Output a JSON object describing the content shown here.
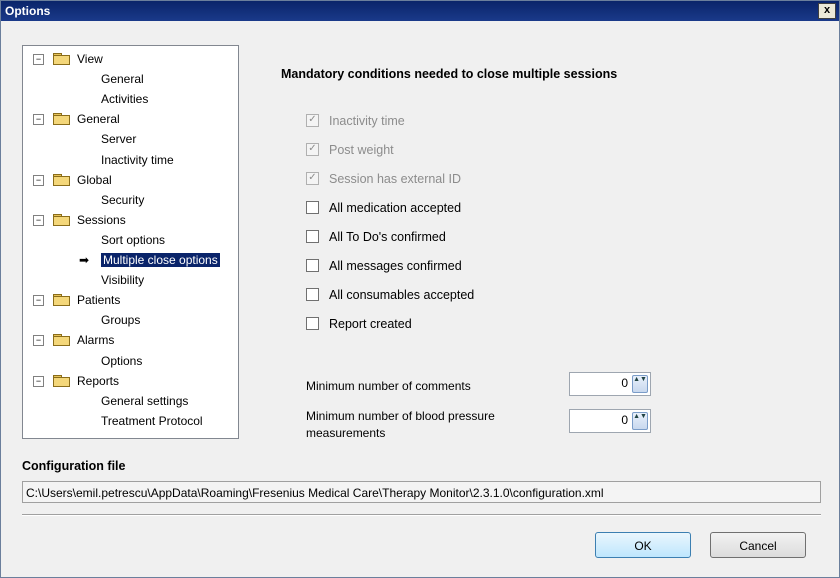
{
  "window": {
    "title": "Options",
    "close_glyph": "x"
  },
  "tree": {
    "groups": [
      {
        "label": "View",
        "children": [
          "General",
          "Activities"
        ]
      },
      {
        "label": "General",
        "children": [
          "Server",
          "Inactivity time"
        ]
      },
      {
        "label": "Global",
        "children": [
          "Security"
        ]
      },
      {
        "label": "Sessions",
        "children": [
          "Sort options",
          "Multiple close options",
          "Visibility"
        ]
      },
      {
        "label": "Patients",
        "children": [
          "Groups"
        ]
      },
      {
        "label": "Alarms",
        "children": [
          "Options"
        ]
      },
      {
        "label": "Reports",
        "children": [
          "General settings",
          "Treatment Protocol"
        ]
      }
    ],
    "selected": "Multiple close options",
    "expander_glyph": "−",
    "selected_arrow_glyph": "➡"
  },
  "panel": {
    "heading": "Mandatory conditions needed to close multiple sessions",
    "checkboxes": [
      {
        "label": "Inactivity time",
        "checked": true,
        "disabled": true
      },
      {
        "label": "Post weight",
        "checked": true,
        "disabled": true
      },
      {
        "label": "Session has external ID",
        "checked": true,
        "disabled": true
      },
      {
        "label": "All medication accepted",
        "checked": false,
        "disabled": false
      },
      {
        "label": "All To Do's confirmed",
        "checked": false,
        "disabled": false
      },
      {
        "label": "All messages confirmed",
        "checked": false,
        "disabled": false
      },
      {
        "label": "All consumables accepted",
        "checked": false,
        "disabled": false
      },
      {
        "label": "Report created",
        "checked": false,
        "disabled": false
      }
    ],
    "check_glyph": "✓",
    "min_comments": {
      "label": "Minimum number of comments",
      "value": "0"
    },
    "min_bp": {
      "label_line1": "Minimum number of blood pressure",
      "label_line2": "measurements",
      "value": "0"
    },
    "spin_glyph": "▲▼"
  },
  "config": {
    "title": "Configuration file",
    "path": "C:\\Users\\emil.petrescu\\AppData\\Roaming\\Fresenius Medical Care\\Therapy Monitor\\2.3.1.0\\configuration.xml"
  },
  "buttons": {
    "ok": "OK",
    "cancel": "Cancel"
  },
  "colors": {
    "titlebar": "#0a246a",
    "selection": "#0a246a"
  }
}
